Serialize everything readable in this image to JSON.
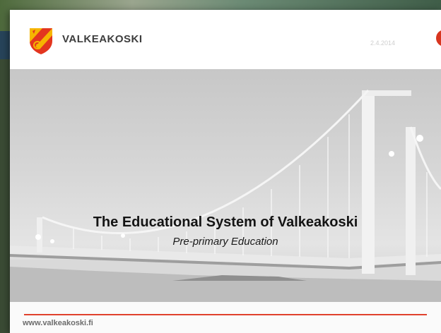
{
  "slide": {
    "logo_text": "VALKEAKOSKI",
    "date": "2.4.2014",
    "title": "The Educational System of Valkeakoski",
    "subtitle": "Pre-primary Education",
    "footer_url": "www.valkeakoski.fi"
  },
  "colors": {
    "accent_red": "#e0412d",
    "logo_red": "#d8351f",
    "logo_yellow": "#f4b400"
  },
  "icons": {
    "logo": "valkeakoski-coat-of-arms-icon"
  }
}
